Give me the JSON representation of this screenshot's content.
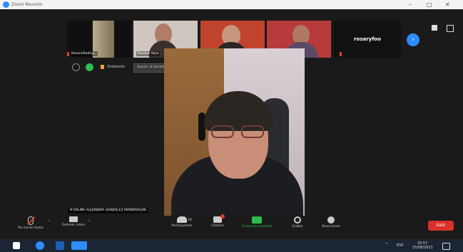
{
  "window": {
    "title": "Zoom Reunión",
    "controls": {
      "minimize": "–",
      "maximize": "□",
      "close": "✕"
    }
  },
  "thumbnails": [
    {
      "name": "RosarioRodrig...",
      "muted": true
    },
    {
      "name": "Rosales Vaca",
      "muted": false
    },
    {
      "name": "Cristina Casilla",
      "muted": true
    },
    {
      "name": "ARMANDO RIVAS...",
      "muted": true
    },
    {
      "name": "rosaryfoo",
      "muted": true
    }
  ],
  "next_arrow": "›",
  "share_bar": {
    "viewing_label": "Grabando",
    "dropdown": "Ajustar al tamaño original ⌄"
  },
  "active_speaker": {
    "name": "Ψ ERLINK ALEJANDRA GONZALEZ MONDRAGON"
  },
  "toolbar": {
    "items": [
      {
        "icon": "muted-mic-icon",
        "label": "Re-iniciar Audio"
      },
      {
        "icon": "video-camera-icon",
        "label": "Detener video"
      },
      {
        "icon": "participants-icon",
        "label": "Participantes",
        "count": "19"
      },
      {
        "icon": "chat-icon",
        "label": "Chatear"
      },
      {
        "icon": "share-screen-icon",
        "label": "Compartir pantalla"
      },
      {
        "icon": "record-icon",
        "label": "Grabar"
      },
      {
        "icon": "reactions-icon",
        "label": "Reacciones"
      }
    ],
    "leave_label": "Salir"
  },
  "taskbar": {
    "language": "ESP",
    "time": "16:57",
    "date": "15/08/2021",
    "chevron": "^"
  },
  "colors": {
    "accent": "#2d8cff",
    "share_green": "#2fbb4f",
    "leave_red": "#d9302a",
    "muted_red": "#e03e2d"
  }
}
